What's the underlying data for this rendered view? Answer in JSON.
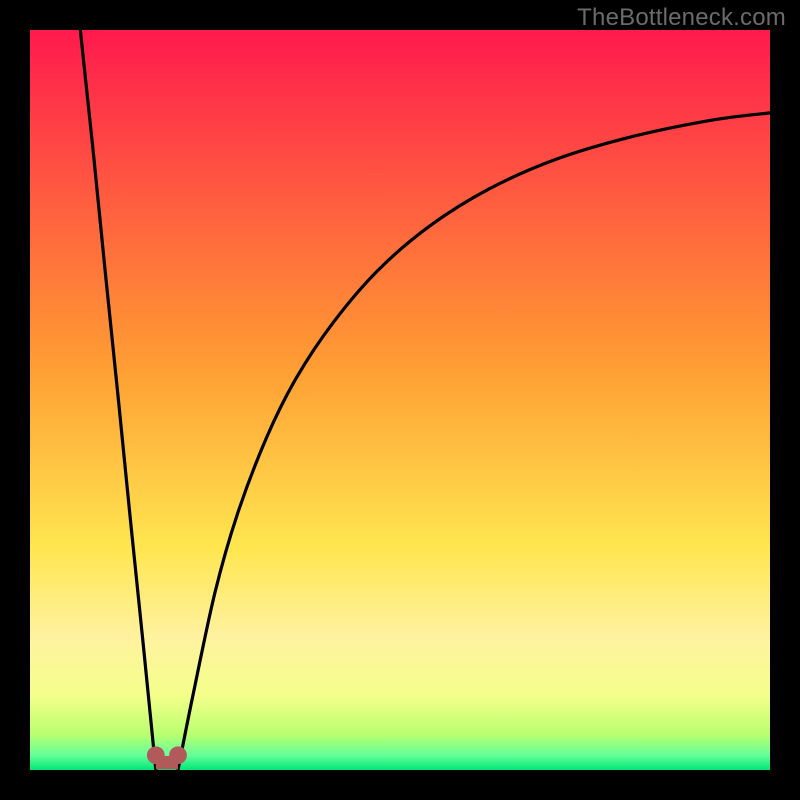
{
  "watermark": "TheBottleneck.com",
  "chart_data": {
    "type": "line",
    "title": "",
    "xlabel": "",
    "ylabel": "",
    "xlim": [
      0,
      100
    ],
    "ylim": [
      0,
      100
    ],
    "background_gradient": {
      "stops": [
        {
          "offset": 0.0,
          "color": "#ff1a4d"
        },
        {
          "offset": 0.45,
          "color": "#ff9c33"
        },
        {
          "offset": 0.7,
          "color": "#ffe650"
        },
        {
          "offset": 0.82,
          "color": "#fff2a0"
        },
        {
          "offset": 0.9,
          "color": "#f4ff8a"
        },
        {
          "offset": 0.952,
          "color": "#b9ff70"
        },
        {
          "offset": 0.98,
          "color": "#65ff99"
        },
        {
          "offset": 1.0,
          "color": "#00e676"
        }
      ]
    },
    "series": [
      {
        "name": "curve-left",
        "x": [
          6.8,
          8.5,
          10.2,
          11.9,
          13.6,
          15.3,
          17.0
        ],
        "values": [
          100,
          84.0,
          67.0,
          50.5,
          33.5,
          17.0,
          0.0
        ]
      },
      {
        "name": "curve-right",
        "x": [
          20.0,
          22.0,
          25.0,
          28.0,
          32.0,
          36.0,
          41.0,
          47.0,
          54.0,
          62.0,
          71.0,
          81.0,
          92.0,
          100.0
        ],
        "values": [
          0.0,
          10.0,
          24.0,
          34.5,
          45.0,
          53.0,
          60.5,
          67.5,
          73.5,
          78.5,
          82.5,
          85.5,
          87.8,
          88.8
        ]
      }
    ],
    "minimum_markers": {
      "color": "#b25a5a",
      "radius_value_units": 1.2,
      "points": [
        {
          "x": 17.0,
          "y": 2.0
        },
        {
          "x": 20.0,
          "y": 2.0
        }
      ],
      "connector": {
        "y": 1.0,
        "x1": 17.0,
        "x2": 20.0,
        "thickness_value_units": 1.8
      }
    }
  }
}
